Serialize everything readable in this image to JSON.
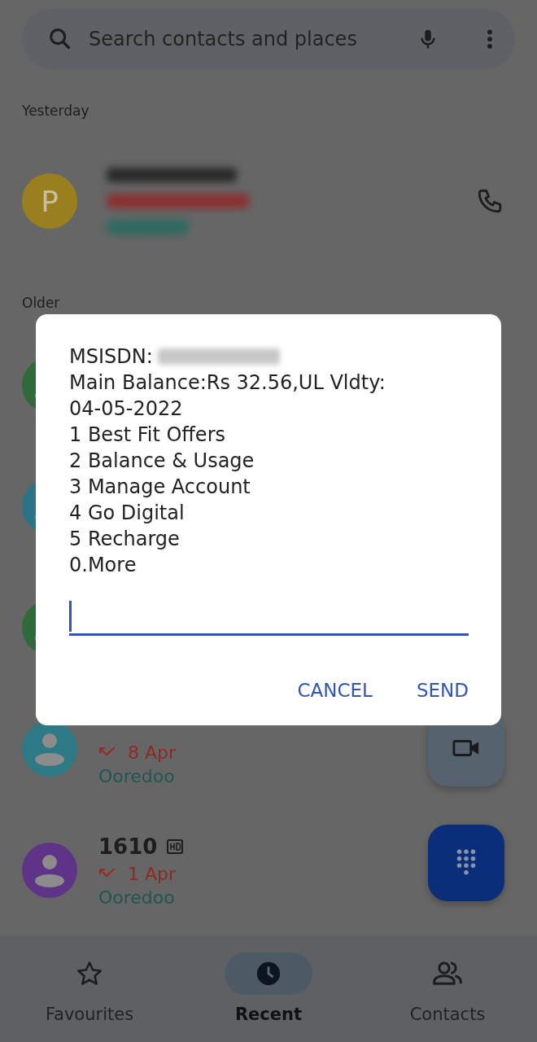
{
  "search": {
    "placeholder": "Search contacts and places"
  },
  "sections": [
    {
      "title": "Yesterday",
      "calls": [
        {
          "kind": "redacted",
          "avatar_letter": "P",
          "color": "#9a7f1f"
        }
      ]
    },
    {
      "title": "Older",
      "calls": [
        {
          "kind": "hidden",
          "color": "#2f6a3a"
        },
        {
          "kind": "hidden",
          "color": "#2b7388"
        },
        {
          "kind": "hidden",
          "color": "#2f6a3a"
        },
        {
          "kind": "call",
          "color": "#2d7a86",
          "missed": true,
          "date": "8 Apr",
          "carrier": "Ooredoo"
        },
        {
          "kind": "call",
          "color": "#5e3388",
          "name": "1610",
          "hd": true,
          "missed": true,
          "date": "1 Apr",
          "carrier": "Ooredoo"
        }
      ]
    }
  ],
  "dialog": {
    "lines": [
      {
        "text": "MSISDN:",
        "redacted": true
      },
      {
        "text": "Main Balance:Rs 32.56,UL Vldty:"
      },
      {
        "text": "04-05-2022"
      },
      {
        "text": "1 Best Fit Offers"
      },
      {
        "text": "2 Balance & Usage"
      },
      {
        "text": "3 Manage Account"
      },
      {
        "text": "4 Go Digital"
      },
      {
        "text": "5 Recharge"
      },
      {
        "text": "0.More"
      }
    ],
    "input": {
      "focused": true
    },
    "buttons": [
      "CANCEL",
      "SEND"
    ]
  },
  "nav": [
    {
      "label": "Favourites",
      "kind": "star",
      "selected": false
    },
    {
      "label": "Recent",
      "kind": "clock",
      "selected": true
    },
    {
      "label": "Contacts",
      "kind": "people",
      "selected": false
    }
  ]
}
